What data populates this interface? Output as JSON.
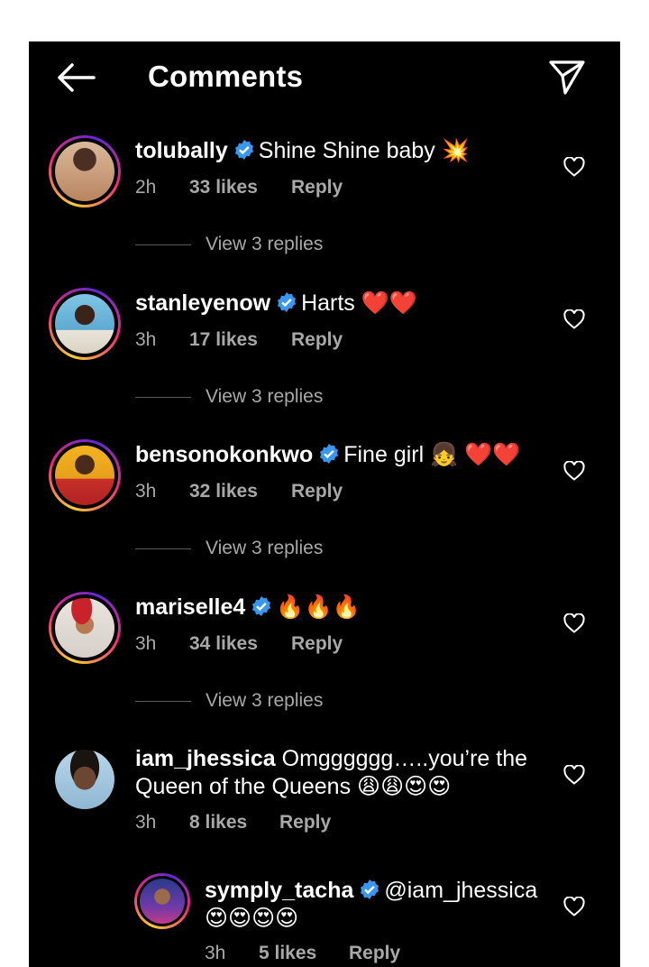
{
  "header": {
    "title": "Comments",
    "back_icon": "arrow-left-icon",
    "send_icon": "paper-plane-icon"
  },
  "comments": [
    {
      "username": "tolubally",
      "verified": true,
      "text": "Shine Shine baby 💥",
      "time": "2h",
      "likes": "33 likes",
      "reply": "Reply",
      "view_replies": "View 3 replies"
    },
    {
      "username": "stanleyenow",
      "verified": true,
      "text": "Harts ❤️❤️",
      "time": "3h",
      "likes": "17 likes",
      "reply": "Reply",
      "view_replies": "View 3 replies"
    },
    {
      "username": "bensonokonkwo",
      "verified": true,
      "text": "Fine girl 👧 ❤️❤️",
      "time": "3h",
      "likes": "32 likes",
      "reply": "Reply",
      "view_replies": "View 3 replies"
    },
    {
      "username": "mariselle4",
      "verified": true,
      "text": "🔥🔥🔥",
      "time": "3h",
      "likes": "34 likes",
      "reply": "Reply",
      "view_replies": "View 3 replies"
    },
    {
      "username": "iam_jhessica",
      "verified": false,
      "text_line1": "Omgggggg…..you’re the",
      "text_line2": "Queen of the Queens 😩😩😍😍",
      "time": "3h",
      "likes": "8 likes",
      "reply": "Reply"
    }
  ],
  "nested_reply": {
    "username": "symply_tacha",
    "verified": true,
    "text_line1": "@iam_jhessica",
    "text_line2": "😍😍😍😍",
    "time": "3h",
    "likes": "5 likes",
    "reply": "Reply"
  },
  "colors": {
    "background": "#000000",
    "text": "#ffffff",
    "meta": "#a8a8a8",
    "verified": "#3897f0"
  }
}
